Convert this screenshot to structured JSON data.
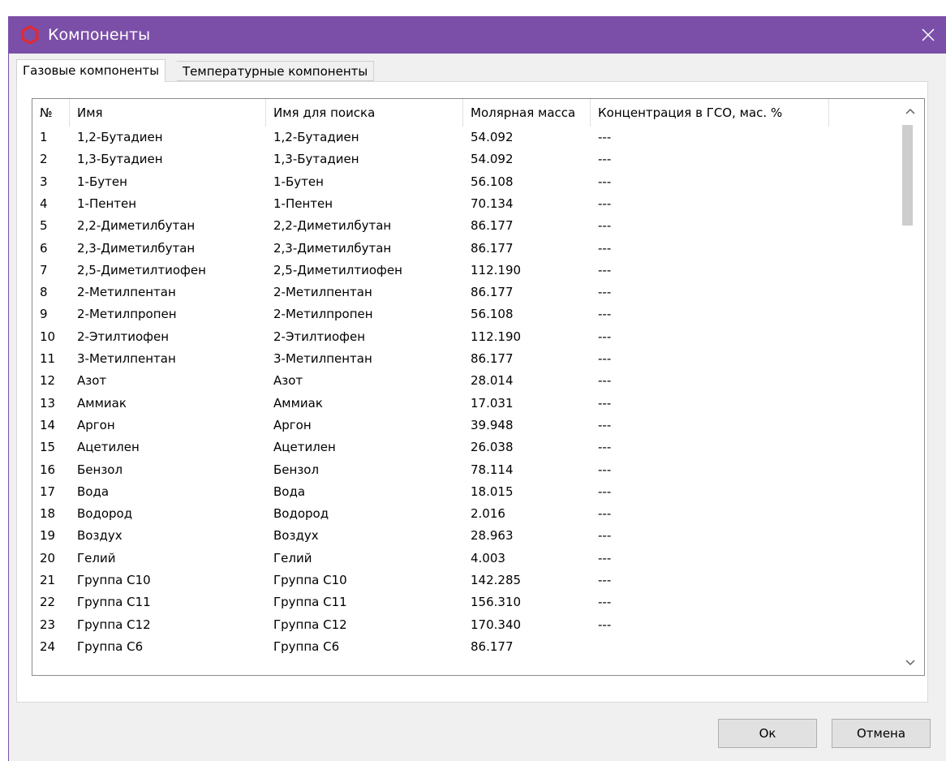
{
  "window": {
    "title": "Компоненты"
  },
  "tabs": [
    {
      "label": "Газовые компоненты"
    },
    {
      "label": "Температурные компоненты"
    }
  ],
  "table": {
    "columns": [
      "№",
      "Имя",
      "Имя для поиска",
      "Молярная масса",
      "Концентрация в ГСО, мас. %"
    ],
    "rows": [
      [
        "1",
        "1,2-Бутадиен",
        "1,2-Бутадиен",
        "54.092",
        "---"
      ],
      [
        "2",
        "1,3-Бутадиен",
        "1,3-Бутадиен",
        "54.092",
        "---"
      ],
      [
        "3",
        "1-Бутен",
        "1-Бутен",
        "56.108",
        "---"
      ],
      [
        "4",
        "1-Пентен",
        "1-Пентен",
        "70.134",
        "---"
      ],
      [
        "5",
        "2,2-Диметилбутан",
        "2,2-Диметилбутан",
        "86.177",
        "---"
      ],
      [
        "6",
        "2,3-Диметилбутан",
        "2,3-Диметилбутан",
        "86.177",
        "---"
      ],
      [
        "7",
        "2,5-Диметилтиофен",
        "2,5-Диметилтиофен",
        "112.190",
        "---"
      ],
      [
        "8",
        "2-Метилпентан",
        "2-Метилпентан",
        "86.177",
        "---"
      ],
      [
        "9",
        "2-Метилпропен",
        "2-Метилпропен",
        "56.108",
        "---"
      ],
      [
        "10",
        "2-Этилтиофен",
        "2-Этилтиофен",
        "112.190",
        "---"
      ],
      [
        "11",
        "3-Метилпентан",
        "3-Метилпентан",
        "86.177",
        "---"
      ],
      [
        "12",
        "Азот",
        "Азот",
        "28.014",
        "---"
      ],
      [
        "13",
        "Аммиак",
        "Аммиак",
        "17.031",
        "---"
      ],
      [
        "14",
        "Аргон",
        "Аргон",
        "39.948",
        "---"
      ],
      [
        "15",
        "Ацетилен",
        "Ацетилен",
        "26.038",
        "---"
      ],
      [
        "16",
        "Бензол",
        "Бензол",
        "78.114",
        "---"
      ],
      [
        "17",
        "Вода",
        "Вода",
        "18.015",
        "---"
      ],
      [
        "18",
        "Водород",
        "Водород",
        "2.016",
        "---"
      ],
      [
        "19",
        "Воздух",
        "Воздух",
        "28.963",
        "---"
      ],
      [
        "20",
        "Гелий",
        "Гелий",
        "4.003",
        "---"
      ],
      [
        "21",
        "Группа C10",
        "Группа C10",
        "142.285",
        "---"
      ],
      [
        "22",
        "Группа C11",
        "Группа C11",
        "156.310",
        "---"
      ],
      [
        "23",
        "Группа C12",
        "Группа C12",
        "170.340",
        "---"
      ],
      [
        "24",
        "Группа C6",
        "Группа C6",
        "86.177",
        ""
      ]
    ]
  },
  "buttons": {
    "ok": "Ок",
    "cancel": "Отмена"
  },
  "colors": {
    "titlebar": "#7b4fa7",
    "app_icon": "#e8272d"
  },
  "icons": {
    "app": "hexagon-icon",
    "close": "close-icon",
    "scroll_up": "chevron-up-icon",
    "scroll_down": "chevron-down-icon"
  }
}
